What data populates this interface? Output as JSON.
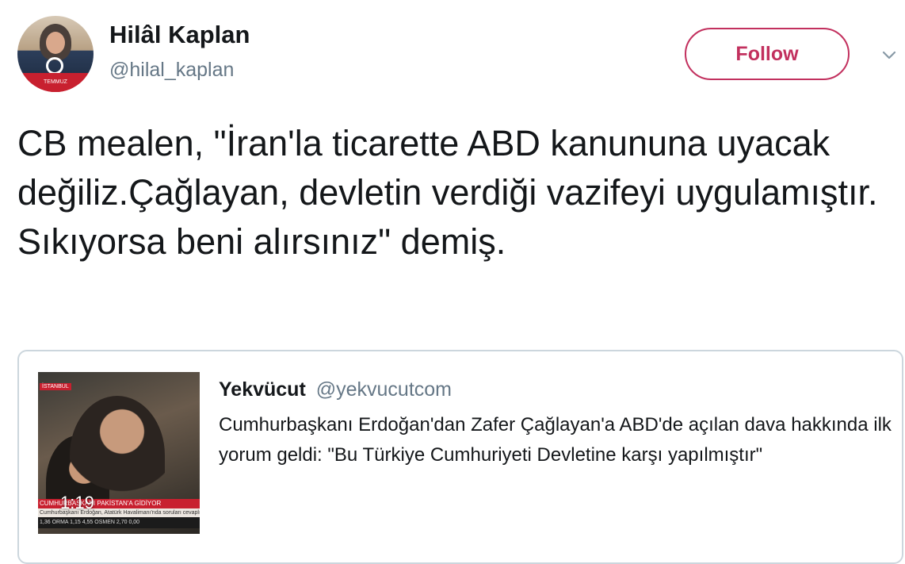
{
  "author": {
    "name": "Hilâl Kaplan",
    "handle": "@hilal_kaplan",
    "avatar_badge": "TEMMUZ"
  },
  "follow_label": "Follow",
  "tweet": {
    "text": "CB mealen, \"İran'la ticarette ABD kanununa uyacak değiliz.Çağlayan, devletin verdiği vazifeyi uygulamıştır. Sıkıyorsa beni alırsınız\" demiş."
  },
  "quoted": {
    "name": "Yekvücut",
    "handle": "@yekvucutcom",
    "text": "Cumhurbaşkanı Erdoğan'dan Zafer Çağlayan'a ABD'de açılan dava hakkında ilk yorum geldi: \"Bu Türkiye Cumhuriyeti Devletine karşı yapılmıştır\"",
    "media": {
      "duration": "1:19",
      "tag": "İSTANBUL",
      "ticker": "CUMHURBAŞKANI PAKİSTAN'A GİDİYOR",
      "ticker_sub": "Cumhurbaşkanı Erdoğan, Atatürk Havalimanı'nda soruları cevaplıyor",
      "ticker_market": "1,36   ORMA 1,15   4,55   OSMEN 2,70   0,00"
    }
  },
  "colors": {
    "follow_accent": "#c2305e",
    "text_primary": "#14171a",
    "text_secondary": "#657786",
    "card_border": "#ccd6dd"
  },
  "icons": {
    "menu": "chevron-down-icon"
  }
}
